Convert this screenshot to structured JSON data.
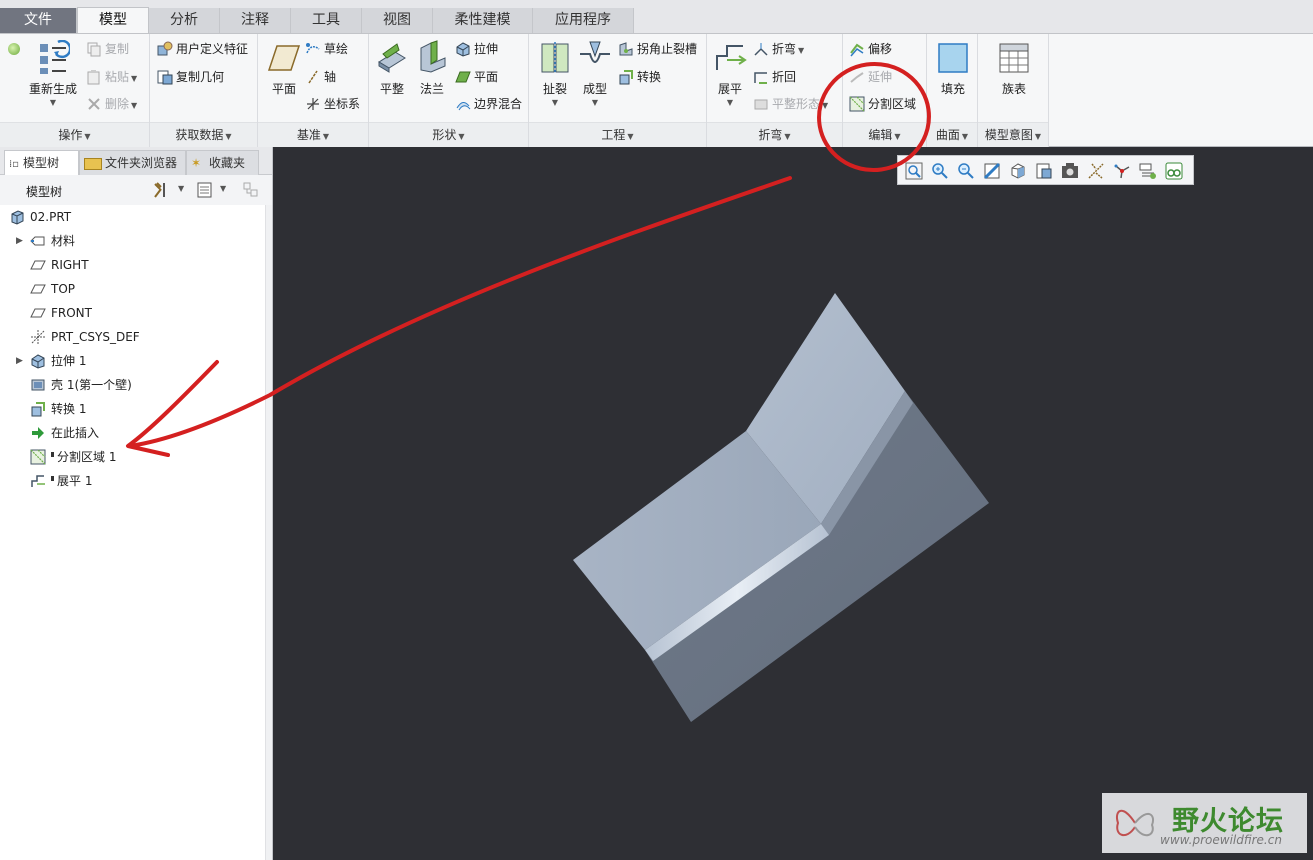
{
  "tabs": [
    {
      "label": "文件"
    },
    {
      "label": "模型"
    },
    {
      "label": "分析"
    },
    {
      "label": "注释"
    },
    {
      "label": "工具"
    },
    {
      "label": "视图"
    },
    {
      "label": "柔性建模"
    },
    {
      "label": "应用程序"
    }
  ],
  "active_tab": "模型",
  "ribbon": {
    "operations": {
      "title": "操作",
      "regenerate": "重新生成",
      "copy": "复制",
      "paste": "粘贴",
      "delete": "删除"
    },
    "get_data": {
      "title": "获取数据",
      "udf": "用户定义特征",
      "copy_geom": "复制几何"
    },
    "datum": {
      "title": "基准",
      "plane": "平面",
      "sketch": "草绘",
      "axis": "轴",
      "csys": "坐标系"
    },
    "shape": {
      "title": "形状",
      "flat": "平整",
      "flange": "法兰",
      "extrude": "拉伸",
      "plane": "平面",
      "blend": "边界混合"
    },
    "engineering": {
      "title": "工程",
      "rip": "扯裂",
      "form": "成型",
      "corner_relief": "拐角止裂槽",
      "convert": "转换"
    },
    "bend": {
      "title": "折弯",
      "unbend": "展平",
      "bend": "折弯",
      "bend_back": "折回",
      "flat_state": "平整形态"
    },
    "edit": {
      "title": "编辑",
      "offset": "偏移",
      "extend": "延伸",
      "split_area": "分割区域"
    },
    "surface": {
      "title": "曲面",
      "fill": "填充"
    },
    "model_intent": {
      "title": "模型意图",
      "family_table": "族表"
    }
  },
  "panel": {
    "tabs": [
      "模型树",
      "文件夹浏览器",
      "收藏夹"
    ],
    "title": "模型树"
  },
  "tree": [
    {
      "label": "02.PRT",
      "icon": "part-icon",
      "expandable": false
    },
    {
      "label": "材料",
      "icon": "material-icon",
      "expandable": true
    },
    {
      "label": "RIGHT",
      "icon": "datum-plane-icon",
      "expandable": false
    },
    {
      "label": "TOP",
      "icon": "datum-plane-icon",
      "expandable": false
    },
    {
      "label": "FRONT",
      "icon": "datum-plane-icon",
      "expandable": false
    },
    {
      "label": "PRT_CSYS_DEF",
      "icon": "csys-icon",
      "expandable": false
    },
    {
      "label": "拉伸 1",
      "icon": "extrude-icon",
      "expandable": true
    },
    {
      "label": "壳 1(第一个壁)",
      "icon": "shell-icon",
      "expandable": false
    },
    {
      "label": "转换 1",
      "icon": "convert-icon",
      "expandable": false
    },
    {
      "label": "在此插入",
      "icon": "insert-arrow-icon",
      "expandable": false
    },
    {
      "label": "分割区域 1",
      "icon": "split-area-icon",
      "expandable": false,
      "marker": true
    },
    {
      "label": "展平 1",
      "icon": "unbend-icon",
      "expandable": false,
      "marker": true
    }
  ],
  "viewport_toolbar": [
    "refit-icon",
    "zoom-in-icon",
    "zoom-out-icon",
    "repaint-icon",
    "display-style-icon",
    "saved-views-icon",
    "view-manager-icon",
    "datum-display-icon",
    "spin-center-icon",
    "annotation-display-icon",
    "appearance-icon"
  ],
  "watermark": {
    "text": "野火论坛",
    "url": "www.proewildfire.cn"
  },
  "colors": {
    "annotation_red": "#d42020",
    "part_light": "#a7b3c3",
    "part_dark": "#6c7685",
    "viewport_bg": "#2e2f34"
  }
}
